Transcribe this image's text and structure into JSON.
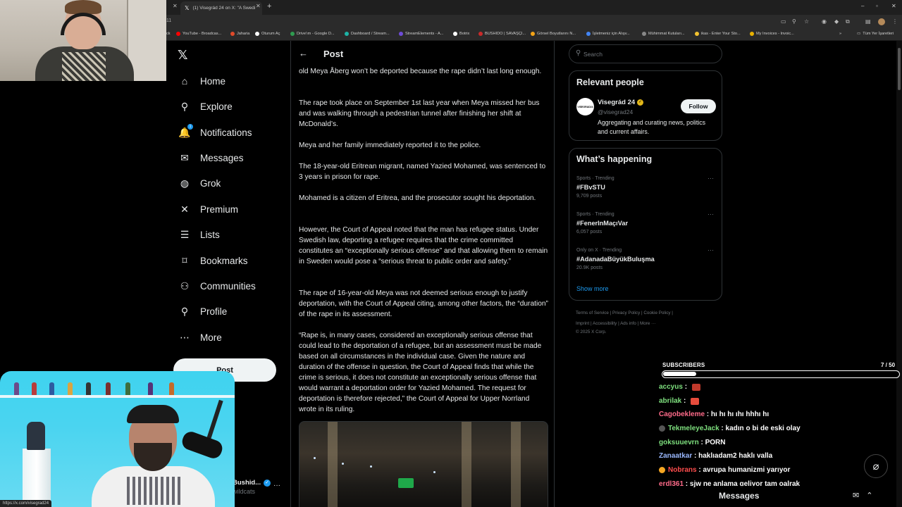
{
  "browser": {
    "tab_title": "(1) Visegrád 24 on X: \"A Swedi",
    "bookmarks": [
      {
        "label": "YouTube - Broadcas...",
        "color": "#ff0000"
      },
      {
        "label": "Jaharia",
        "color": "#e04a2a"
      },
      {
        "label": "Oturum Aç",
        "color": "#ffffff"
      },
      {
        "label": "Drive'ım - Google D...",
        "color": "#2f9b50"
      },
      {
        "label": "Dashboard / Stream...",
        "color": "#1db3a6"
      },
      {
        "label": "StreamElements - A...",
        "color": "#6e4bd8"
      },
      {
        "label": "Botrix",
        "color": "#ffffff"
      },
      {
        "label": "BUSHIDO | SAVAŞÇI...",
        "color": "#c92a2a"
      },
      {
        "label": "Görsel Boyutlarını N...",
        "color": "#f3a317"
      },
      {
        "label": "İşletmeniz için Alışv...",
        "color": "#4285f4"
      },
      {
        "label": "Mühimmat Kutuları...",
        "color": "#888888"
      },
      {
        "label": "ikas - Enter Your Sto...",
        "color": "#f2c230"
      },
      {
        "label": "My Invoices - Invoic...",
        "color": "#e9b100"
      }
    ],
    "other_bookmarks": "Tüm Yer İşaretleri",
    "status_url": "https://x.com/visegrad24"
  },
  "nav": {
    "items": [
      {
        "label": "Home",
        "icon": "home-icon",
        "glyph": "⌂"
      },
      {
        "label": "Explore",
        "icon": "search-icon",
        "glyph": "⚲"
      },
      {
        "label": "Notifications",
        "icon": "bell-icon",
        "glyph": "🔔"
      },
      {
        "label": "Messages",
        "icon": "envelope-icon",
        "glyph": "✉"
      },
      {
        "label": "Grok",
        "icon": "grok-icon",
        "glyph": "◍"
      },
      {
        "label": "Premium",
        "icon": "x-premium-icon",
        "glyph": "✕"
      },
      {
        "label": "Lists",
        "icon": "list-icon",
        "glyph": "☰"
      },
      {
        "label": "Bookmarks",
        "icon": "bookmark-icon",
        "glyph": "⌑"
      },
      {
        "label": "Communities",
        "icon": "people-icon",
        "glyph": "⚇"
      },
      {
        "label": "Profile",
        "icon": "person-icon",
        "glyph": "⚲"
      },
      {
        "label": "More",
        "icon": "more-circle-icon",
        "glyph": "⋯"
      }
    ],
    "post_button": "Post",
    "account_name": "Bushid...",
    "account_handle": "wildcats"
  },
  "post": {
    "header_title": "Post",
    "paragraphs": [
      "old Meya Åberg won’t be deported because the rape didn’t last long enough.",
      "The rape took place on September 1st last year when Meya missed her bus and was walking through a pedestrian tunnel after finishing her shift at McDonald’s.",
      "Meya and her family immediately reported it to the police.",
      "The 18-year-old Eritrean migrant, named Yazied Mohamed, was sentenced to 3 years in prison for rape.",
      "Mohamed is a citizen of Eritrea, and the prosecutor sought his deportation.",
      "However, the Court of Appeal noted that the man has refugee status. Under Swedish law, deporting a refugee requires that the crime committed constitutes an “exceptionally serious offense” and that allowing them to remain in Sweden would pose a “serious threat to public order and safety.”",
      "The rape of 16-year-old Meya was not deemed serious enough to justify deportation, with the Court of Appeal citing, among other factors, the “duration” of the rape in its assessment.",
      "“Rape is, in many cases, considered an exceptionally serious offense that could lead to the deportation of a refugee, but an assessment must be made based on all circumstances in the individual case. Given the nature and duration of the offense in question, the Court of Appeal finds that while the crime is serious, it does not constitute an exceptionally serious offense that would warrant a deportation order for Yazied Mohamed. The request for deportation is therefore rejected,” the Court of Appeal for Upper Norrland wrote in its ruling."
    ]
  },
  "sidebar": {
    "search_placeholder": "Search",
    "relevant": {
      "title": "Relevant people",
      "name": "Visegrád 24",
      "handle": "@visegrad24",
      "bio": "Aggregating and curating news, politics and current affairs.",
      "follow": "Follow"
    },
    "happening": {
      "title": "What’s happening",
      "trends": [
        {
          "meta": "Sports · Trending",
          "name": "#FBvSTU",
          "count": "9,709 posts"
        },
        {
          "meta": "Sports · Trending",
          "name": "#FenerInMaçıVar",
          "count": "6,057 posts"
        },
        {
          "meta": "Only on X · Trending",
          "name": "#AdanadaBüyükBuluşma",
          "count": "20.9K posts"
        }
      ],
      "show_more": "Show more"
    },
    "footer_line1": "Terms of Service  |  Privacy Policy  |  Cookie Policy  |",
    "footer_line2": "Imprint  |  Accessibility  |  Ads info  |  More ···",
    "footer_line3": "© 2025 X Corp."
  },
  "stream": {
    "subs_label": "SUBSCRIBERS",
    "subs_count": "7 / 50",
    "subs_progress": 0.14,
    "chat": [
      {
        "user": "accyus",
        "color": "#7ee07e",
        "text": " : ",
        "emote": "#c0392b",
        "badge": ""
      },
      {
        "user": "abrilak",
        "color": "#7ee07e",
        "text": " : ",
        "emote": "#e74c3c",
        "badge": ""
      },
      {
        "user": "Cagobekleme",
        "color": "#ff6b8a",
        "text": " : hı hı hı ıhı hhhı hı",
        "emote": "",
        "badge": ""
      },
      {
        "user": "TekmeleyeJack",
        "color": "#7ee07e",
        "text": " : kadın o bi de eski olay",
        "emote": "",
        "badge": "#555555"
      },
      {
        "user": "goksuuevrn",
        "color": "#7ee07e",
        "text": " : PORN",
        "emote": "",
        "badge": ""
      },
      {
        "user": "Zanaatkar",
        "color": "#9ab8ff",
        "text": " : haklıadam2 haklı valla",
        "emote": "",
        "badge": ""
      },
      {
        "user": "Nobrans",
        "color": "#ff4d4d",
        "text": " : avrupa humanizmi yarıyor",
        "emote": "",
        "badge": "#f5a623"
      },
      {
        "user": "erdl361",
        "color": "#ff6b8a",
        "text": " : sjw ne anlama geliyor tam oalrak",
        "emote": "",
        "badge": ""
      }
    ]
  },
  "messages_drawer": {
    "title": "Messages"
  }
}
